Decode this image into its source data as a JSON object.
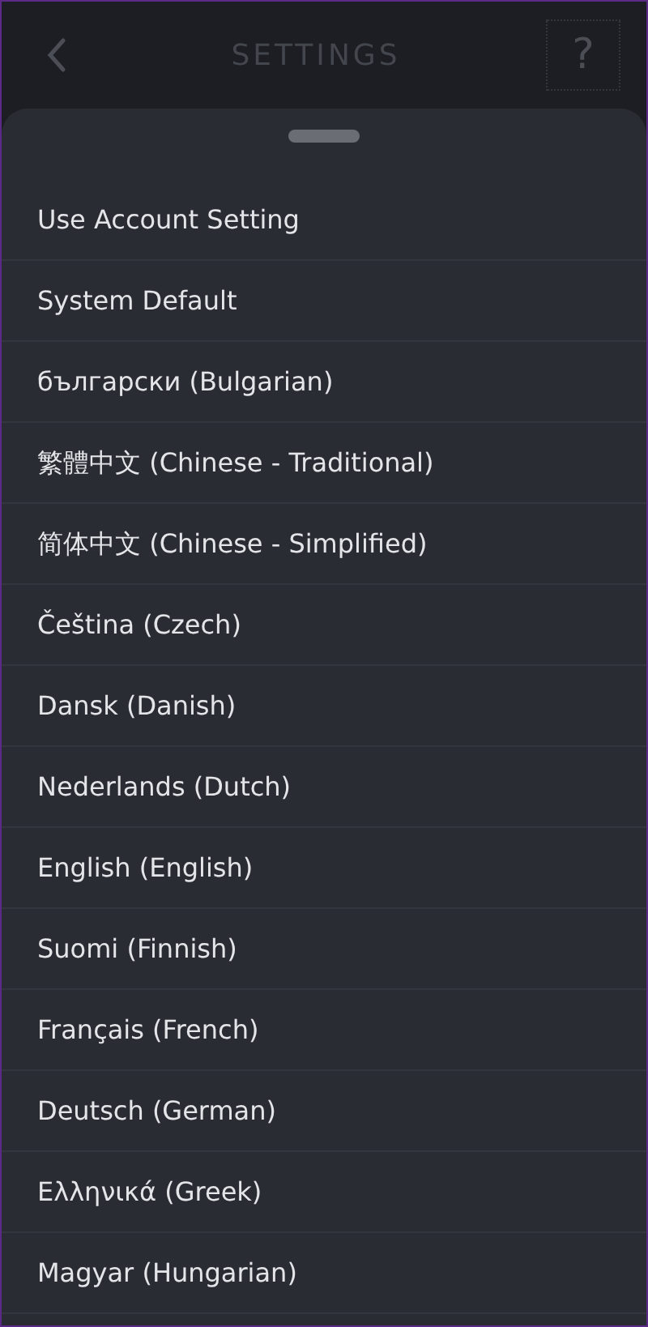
{
  "header": {
    "title": "SETTINGS",
    "help": "?"
  },
  "languages": [
    {
      "label": "Use Account Setting"
    },
    {
      "label": "System Default"
    },
    {
      "label": "български (Bulgarian)"
    },
    {
      "label": "繁體中文 (Chinese - Traditional)"
    },
    {
      "label": "简体中文 (Chinese - Simplified)"
    },
    {
      "label": "Čeština (Czech)"
    },
    {
      "label": "Dansk (Danish)"
    },
    {
      "label": "Nederlands (Dutch)"
    },
    {
      "label": "English (English)"
    },
    {
      "label": "Suomi (Finnish)"
    },
    {
      "label": "Français (French)"
    },
    {
      "label": "Deutsch (German)"
    },
    {
      "label": "Ελληνικά (Greek)"
    },
    {
      "label": "Magyar (Hungarian)"
    }
  ]
}
